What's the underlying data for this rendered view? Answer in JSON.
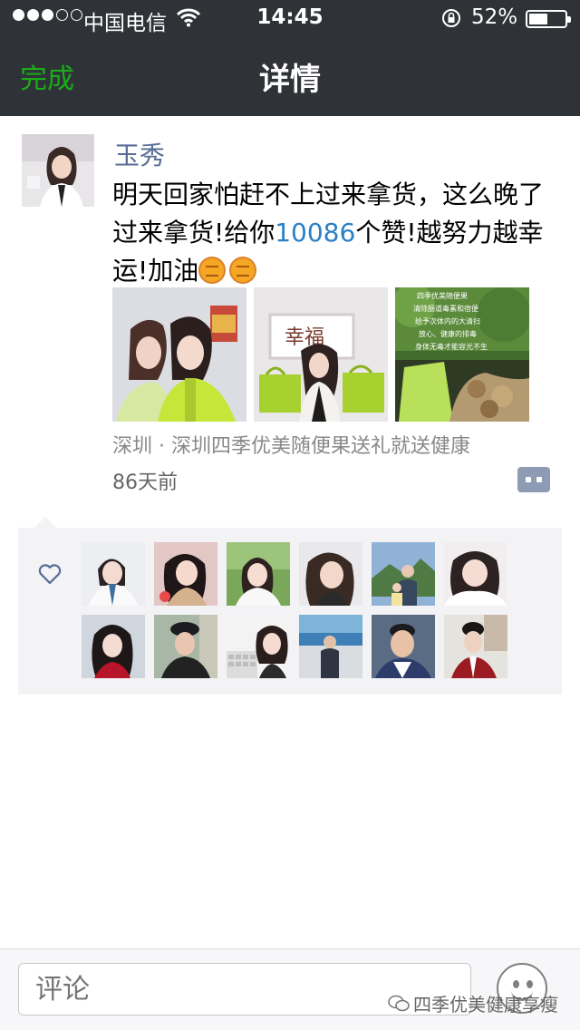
{
  "status_bar": {
    "carrier": "中国电信",
    "time": "14:45",
    "battery_percent": "52%",
    "signal_strength": 3,
    "battery_level": 0.52
  },
  "nav": {
    "done_label": "完成",
    "title": "详情"
  },
  "post": {
    "author": "玉秀",
    "text_before": "明天回家怕赶不上过来拿货，这么晚了过来拿货!给你",
    "text_number": "10086",
    "text_after": "个赞!越努力越幸运!加油",
    "location": "深圳 · 深圳四季优美随便果送礼就送健康",
    "time_ago": "86天前",
    "photo_1_sign": "幸福",
    "photo_3_caption": "四季优美随便果\n清除肠道毒素和宿便\n给予次体内的大清扫\n放心、健康的排毒\n身体无毒才能容光不生"
  },
  "likes": {
    "count": 12
  },
  "comment_bar": {
    "placeholder": "评论"
  },
  "watermark": {
    "text": "四季优美健康享瘦"
  },
  "colors": {
    "nav_bg": "#2f3237",
    "done_green": "#1aad19",
    "username_blue": "#576b95",
    "link_blue": "#2a7fc7",
    "likes_bg": "#f3f3f5"
  }
}
